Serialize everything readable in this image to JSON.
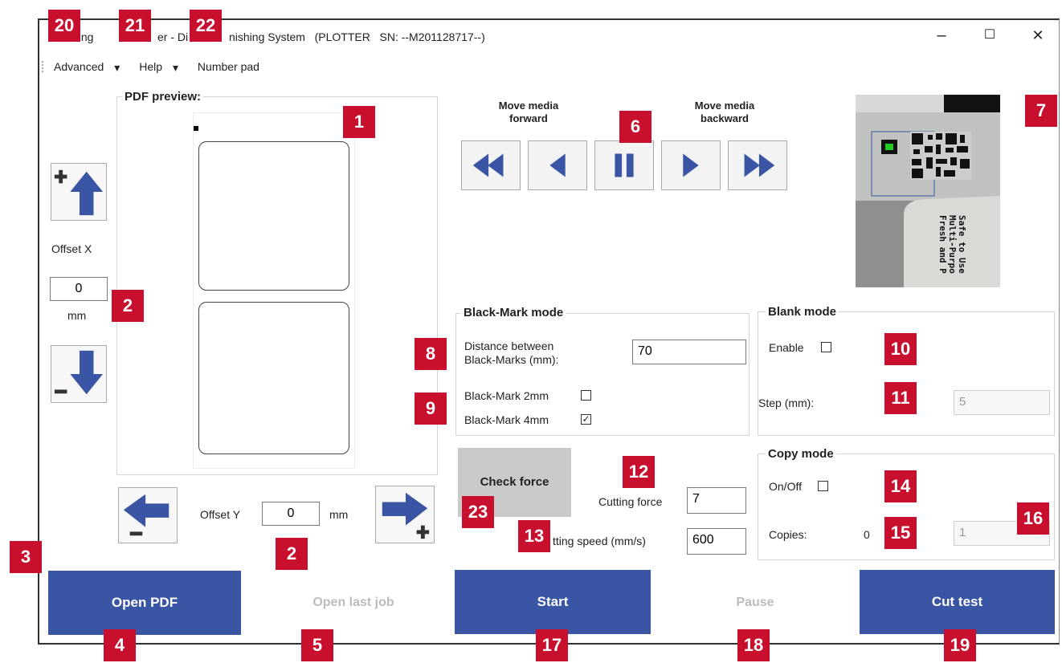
{
  "window": {
    "title_part1": "tting",
    "title_part2": "er - Di",
    "title_part3": "nishing System   (PLOTTER   SN: --M201128717--)",
    "minimize_glyph": "–",
    "maximize_glyph": "☐",
    "close_glyph": "✕"
  },
  "menu": {
    "advanced": "Advanced",
    "help": "Help",
    "number_pad": "Number pad",
    "caret": "▾"
  },
  "pdf_preview": {
    "title": "PDF preview:"
  },
  "offset_x": {
    "label": "Offset X",
    "value": "0",
    "unit": "mm"
  },
  "offset_y": {
    "label": "Offset Y",
    "value": "0",
    "unit": "mm"
  },
  "media": {
    "forward_label": "Move media\nforward",
    "backward_label": "Move media\nbackward",
    "buttons": [
      {
        "name": "fast-rewind-icon"
      },
      {
        "name": "rewind-icon"
      },
      {
        "name": "pause-icon"
      },
      {
        "name": "play-icon"
      },
      {
        "name": "fast-forward-icon"
      }
    ]
  },
  "camera": {
    "label_lines": [
      "Safe to Use",
      "Multi-Purpo",
      "Fresh and P"
    ]
  },
  "black_mark": {
    "title": "Black-Mark mode",
    "distance_label_1": "Distance between",
    "distance_label_2": "Black-Marks (mm):",
    "distance_value": "70",
    "mark2_label": "Black-Mark 2mm",
    "mark2_checked": false,
    "mark4_label": "Black-Mark 4mm",
    "mark4_checked": true
  },
  "blank_mode": {
    "title": "Blank mode",
    "enable_label": "Enable",
    "enable_checked": false,
    "step_label": "Step (mm):",
    "step_value": "5"
  },
  "copy_mode": {
    "title": "Copy mode",
    "onoff_label": "On/Off",
    "onoff_checked": false,
    "copies_label": "Copies:",
    "copies_count": "0",
    "copies_value": "1"
  },
  "cutting": {
    "check_force_label": "Check force",
    "force_label": "Cutting force",
    "force_value": "7",
    "speed_label": "tting speed (mm/s)",
    "speed_value": "600"
  },
  "actions": {
    "open_pdf": "Open PDF",
    "open_last_job": "Open last job",
    "start": "Start",
    "pause": "Pause",
    "cut_test": "Cut test"
  },
  "badges": {
    "b1": "1",
    "b2a": "2",
    "b2b": "2",
    "b3": "3",
    "b4": "4",
    "b5": "5",
    "b6": "6",
    "b7": "7",
    "b8": "8",
    "b9": "9",
    "b10": "10",
    "b11": "11",
    "b12": "12",
    "b13": "13",
    "b14": "14",
    "b15": "15",
    "b16": "16",
    "b17": "17",
    "b18": "18",
    "b19": "19",
    "b20": "20",
    "b21": "21",
    "b22": "22",
    "b23": "23"
  },
  "colors": {
    "accent_blue": "#3a55a4",
    "badge_red": "#c8102e"
  }
}
